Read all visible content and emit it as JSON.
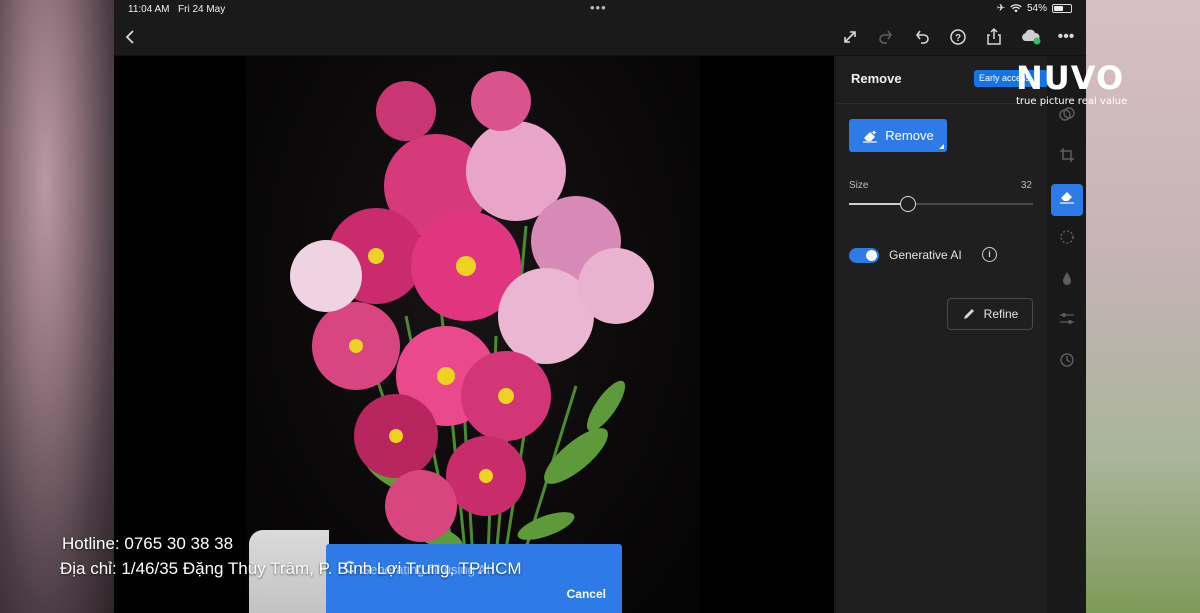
{
  "status_bar": {
    "time": "11:04 AM",
    "date": "Fri 24 May",
    "battery": "54%"
  },
  "toolbar": {
    "icons": [
      "back-icon",
      "expand-icon",
      "redo-icon",
      "undo-icon",
      "help-icon",
      "share-icon",
      "cloud-sync-icon",
      "more-icon"
    ]
  },
  "panel": {
    "title": "Remove",
    "badge": "Early access",
    "remove_button": "Remove",
    "size_label": "Size",
    "size_value": "32",
    "size_fraction": 0.32,
    "generative_ai_label": "Generative AI",
    "generative_ai_enabled": true,
    "refine_button": "Refine"
  },
  "rail": {
    "items": [
      "presets-icon",
      "crop-icon",
      "remove-icon",
      "masking-icon",
      "healing-icon",
      "adjustments-icon",
      "history-icon"
    ],
    "active": "remove-icon"
  },
  "toast": {
    "text": "Generating fill using AI",
    "cancel": "Cancel"
  },
  "watermark": {
    "brand": "NUVO",
    "tagline": "true picture real value",
    "hotline": "Hotline: 0765 30 38 38",
    "address": "Địa chỉ: 1/46/35 Đặng Thùy Trâm, P. Bình Lợi Trung, TP.HCM"
  },
  "colors": {
    "accent": "#2e7be8",
    "panel_bg": "#1f1f1f",
    "canvas_bg": "#000000"
  }
}
